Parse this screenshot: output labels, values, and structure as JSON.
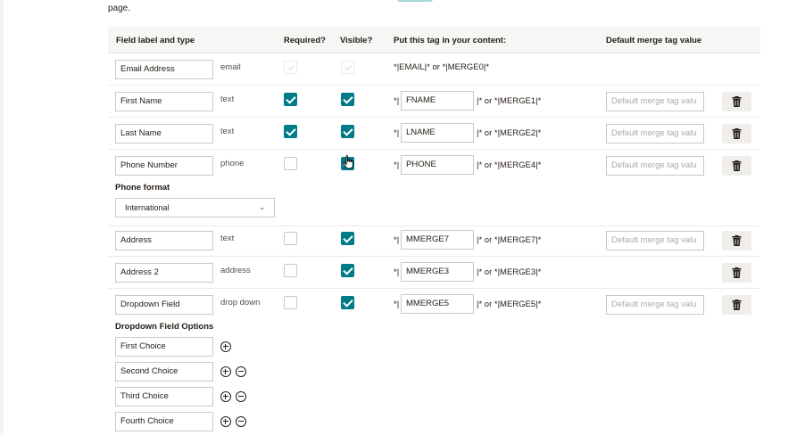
{
  "intro_text": "page.",
  "headers": {
    "field": "Field label and type",
    "required": "Required?",
    "visible": "Visible?",
    "tag": "Put this tag in your content:",
    "default": "Default merge tag value"
  },
  "default_placeholder": "Default merge tag valu",
  "fields": [
    {
      "label": "Email Address",
      "type": "email",
      "required": true,
      "visible": true,
      "locked": true,
      "tag_text": "*|EMAIL|* or *|MERGE0|*"
    },
    {
      "label": "First Name",
      "type": "text",
      "required": true,
      "visible": true,
      "tag_prefix": "*|",
      "tag": "FNAME",
      "tag_suffix": "|* or *|MERGE1|*"
    },
    {
      "label": "Last Name",
      "type": "text",
      "required": true,
      "visible": true,
      "tag_prefix": "*|",
      "tag": "LNAME",
      "tag_suffix": "|* or *|MERGE2|*"
    },
    {
      "label": "Phone Number",
      "type": "phone",
      "required": false,
      "visible": true,
      "tag_prefix": "*|",
      "tag": "PHONE",
      "tag_suffix": "|* or *|MERGE4|*"
    },
    {
      "label": "Address",
      "type": "text",
      "required": false,
      "visible": true,
      "tag_prefix": "*|",
      "tag": "MMERGE7",
      "tag_suffix": "|* or *|MERGE7|*"
    },
    {
      "label": "Address 2",
      "type": "address",
      "required": false,
      "visible": true,
      "tag_prefix": "*|",
      "tag": "MMERGE3",
      "tag_suffix": "|* or *|MERGE3|*"
    },
    {
      "label": "Dropdown Field",
      "type": "drop down",
      "required": false,
      "visible": true,
      "tag_prefix": "*|",
      "tag": "MMERGE5",
      "tag_suffix": "|* or *|MERGE5|*"
    }
  ],
  "phone_format": {
    "label": "Phone format",
    "selected": "International"
  },
  "dropdown_options": {
    "label": "Dropdown Field Options",
    "choices": [
      "First Choice",
      "Second Choice",
      "Third Choice",
      "Fourth Choice"
    ]
  },
  "icons": {
    "trash": "trash-icon",
    "add": "plus-circle-icon",
    "remove": "minus-circle-icon",
    "chevron": "chevron-down-icon",
    "cursor": "hand-pointer-icon"
  },
  "colors": {
    "accent": "#007c89",
    "header_bg": "#f6f6f4",
    "button_bg": "#efeeea",
    "text": "#241c15"
  }
}
